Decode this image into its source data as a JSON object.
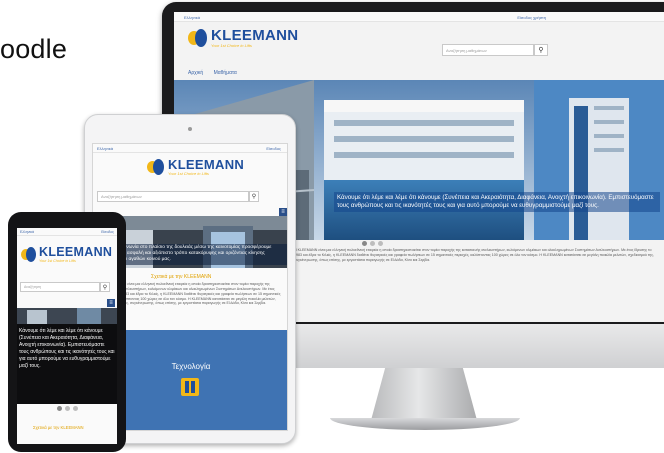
{
  "slide": {
    "title_fragment": "oodle"
  },
  "brand": {
    "name": "KLEEMANN",
    "tagline": "Your 1st Choice in Lifts",
    "colors": {
      "blue": "#1f4f9d",
      "yellow": "#f2b718",
      "link": "#3a64a8"
    }
  },
  "desktop": {
    "topbar_left": "Ελληνικά",
    "topbar_right": "Είσοδος χρήστη",
    "search_placeholder": "Αναζήτηση μαθημάτων",
    "search_icon": "magnifier-icon",
    "nav": [
      "Αρχική",
      "Μαθήματα"
    ],
    "hero_caption": "Κάνουμε ότι λέμε και λέμε ότι κάνουμε (Συνέπεια και Ακεραιότητα, Διαφάνεια, Ανοιχτή επικοινωνία). Εμπιστευόμαστε τους ανθρώπους και τις ικανότητές τους και για αυτό μπορούμε να ευθυγραμμιστούμε μαζί τους.",
    "body_text": "Η KLEEMANN είναι μια ελληνική πολυεθνική εταιρεία η οποία δραστηριοποιείται στον τομέα παροχής της κατασκευής ανελκυστήρων, κυλιόμενων κλιμάκων και ολοκληρωμένων Συστημάτων Ανελκυστήρων. Με έτος ίδρυσης το 1983 και έδρα το Κιλκίς, η KLEEMANN διαθέτει θυγατρικές και γραφεία πωλήσεων σε 15 σημαντικές περιοχές, καλύπτοντας 100 χώρες σε όλο τον κόσμο. Η KLEEMANN κατατάσσει σε μεγάλη ποικιλία μελετών, σχεδιασμού της, συγκέντρωσης, όπως επίσης, με εργοστάσια παραγωγής σε Ελλάδα, Κίνα και Σερβία."
  },
  "tablet": {
    "topbar_left": "Ελληνικά",
    "topbar_right": "Είσοδος",
    "search_placeholder": "Αναζήτηση μαθημάτων",
    "hero_caption": "Ανοιχτή επικοινωνία στο πλαίσιο της δουλειάς μέσω της καινοτομίας προσφέρουμε λύσεις για ένα ασφαλή και αξιόπιστο τρόπο κατακόρυφης και οριζόντιας κίνησης ανθρώπων και αγαθών κοινού μας.",
    "section_title": "Σχετικά με την KLEEMANN",
    "body_text": "Η KLEEMANN είναι μια ελληνική πολυεθνική εταιρεία η οποία δραστηριοποιείται στον τομέα παροχής της κατασκευής ανελκυστήρων, κυλιόμενων κλιμάκων και ολοκληρωμένων Συστημάτων Ανελκυστήρων. Με έτος ίδρυσης το 1983 και έδρα το Κιλκίς, η KLEEMANN διαθέτει θυγατρικές και γραφεία πωλήσεων σε 15 σημαντικές περιοχές, καλύπτοντας 100 χώρες σε όλο τον κόσμο. Η KLEEMANN κατατάσσει σε μεγάλη ποικιλία μελετών, σχεδιασμού της, συγκέντρωσης, όπως επίσης, με εργοστάσια παραγωγής σε Ελλάδα, Κίνα και Σερβία.",
    "tech_title": "Τεχνολογία",
    "tech_icon": "elevator-icon"
  },
  "phone": {
    "topbar_left": "Ελληνικά",
    "topbar_right": "Είσοδος",
    "search_placeholder": "Αναζήτηση",
    "hero_caption": "Κάνουμε ότι λέμε και λέμε ότι κάνουμε (Συνέπεια και Ακεραιότητα, Διαφάνεια, Ανοιχτή επικοινωνία). Εμπιστευόμαστε τους ανθρώπους και τις ικανότητές τους και για αυτό μπορούμε να ευθυγραμμιστούμε μαζί τους.",
    "section_title": "Σχετικά με την KLEEMANN"
  }
}
